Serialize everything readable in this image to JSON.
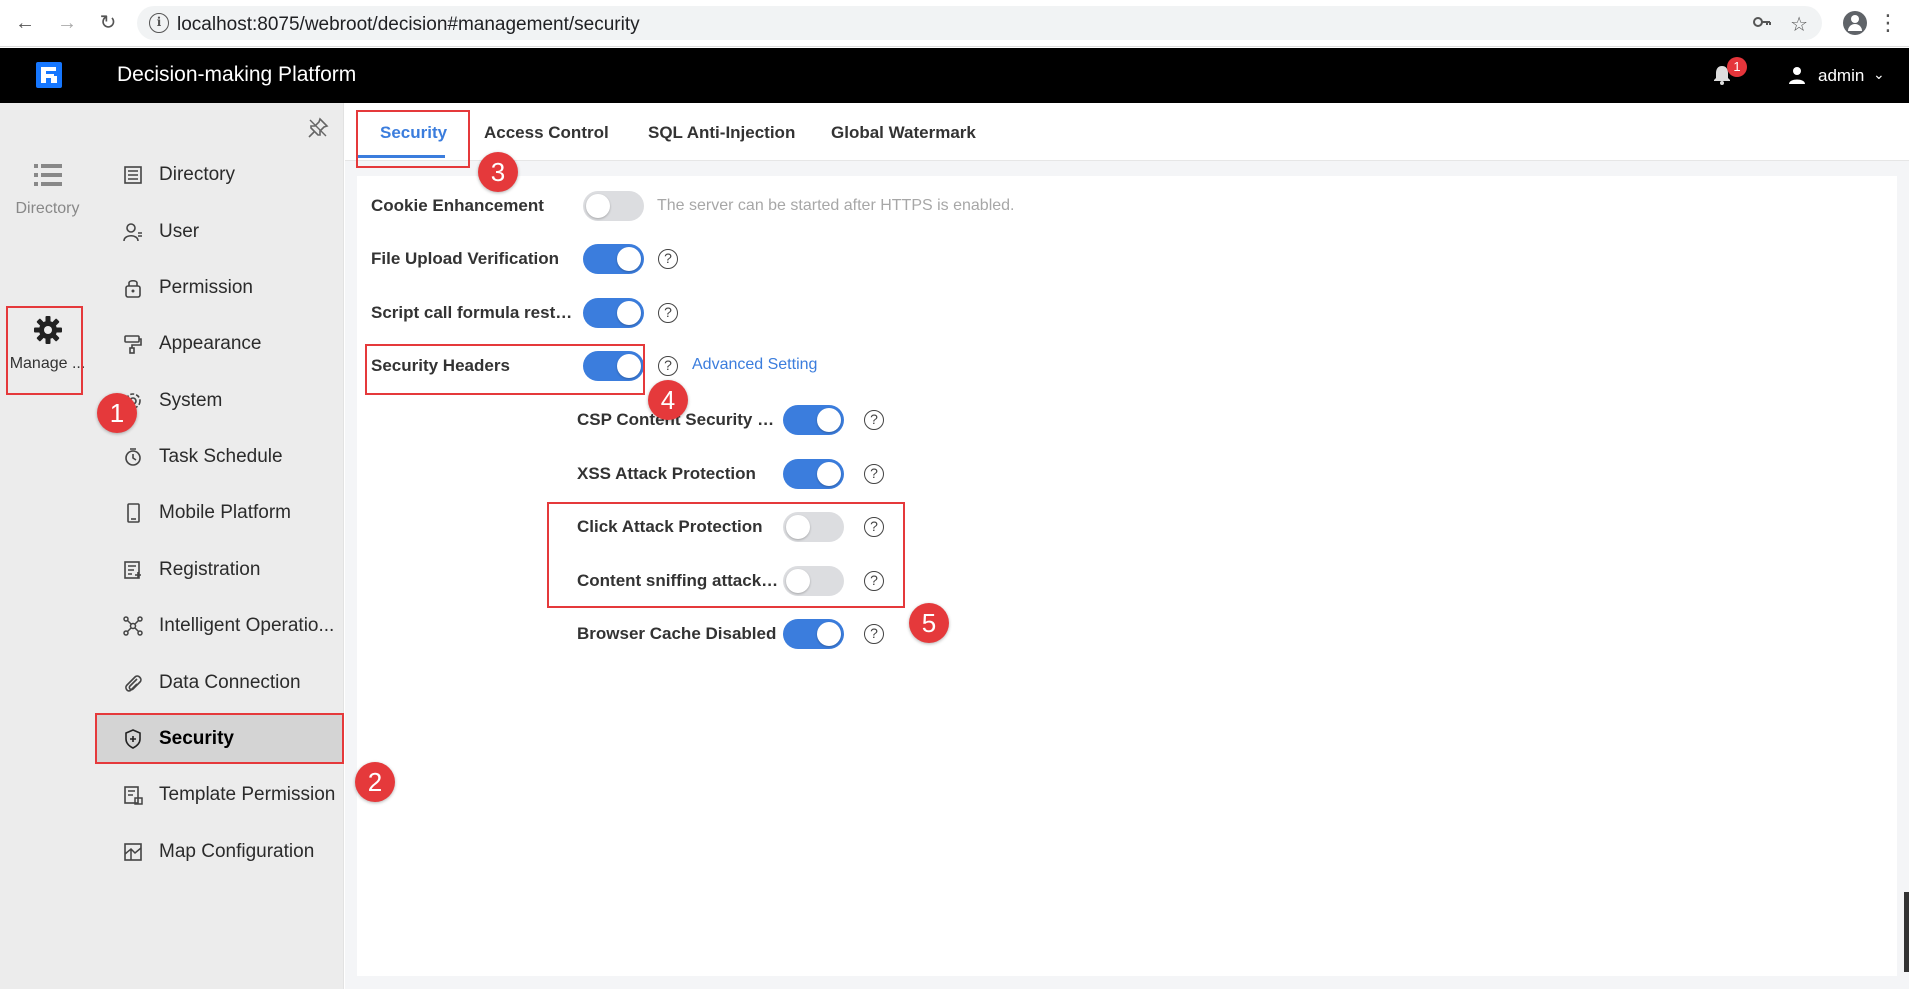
{
  "browser": {
    "url": "localhost:8075/webroot/decision#management/security"
  },
  "header": {
    "title": "Decision-making Platform",
    "notification_count": "1",
    "user_name": "admin"
  },
  "rail": {
    "items": [
      {
        "label": "Directory"
      },
      {
        "label": "Manage ..."
      }
    ]
  },
  "sidebar": {
    "items": [
      {
        "label": "Directory"
      },
      {
        "label": "User"
      },
      {
        "label": "Permission"
      },
      {
        "label": "Appearance"
      },
      {
        "label": "System"
      },
      {
        "label": "Task Schedule"
      },
      {
        "label": "Mobile Platform"
      },
      {
        "label": "Registration"
      },
      {
        "label": "Intelligent Operatio..."
      },
      {
        "label": "Data Connection"
      },
      {
        "label": "Security"
      },
      {
        "label": "Template Permission"
      },
      {
        "label": "Map Configuration"
      }
    ]
  },
  "tabs": [
    {
      "label": "Security"
    },
    {
      "label": "Access Control"
    },
    {
      "label": "SQL Anti-Injection"
    },
    {
      "label": "Global Watermark"
    }
  ],
  "settings": {
    "cookie": {
      "label": "Cookie Enhancement",
      "enabled": false,
      "hint": "The server can be started after HTTPS is enabled."
    },
    "file_upload": {
      "label": "File Upload Verification",
      "enabled": true
    },
    "script_call": {
      "label": "Script call formula restr...",
      "enabled": true
    },
    "security_headers": {
      "label": "Security Headers",
      "enabled": true,
      "link": "Advanced Setting"
    },
    "csp": {
      "label": "CSP Content Security P...",
      "enabled": true
    },
    "xss": {
      "label": "XSS Attack Protection",
      "enabled": true
    },
    "click_attack": {
      "label": "Click Attack Protection",
      "enabled": false
    },
    "content_sniffing": {
      "label": "Content sniffing attack ...",
      "enabled": false
    },
    "browser_cache": {
      "label": "Browser Cache Disabled",
      "enabled": true
    }
  },
  "help_glyph": "?",
  "annotations": [
    "1",
    "2",
    "3",
    "4",
    "5"
  ],
  "colors": {
    "accent": "#3b7ddd",
    "annotation": "#e5393b",
    "header_bg": "#000000",
    "sidebar_bg": "#ececec"
  }
}
